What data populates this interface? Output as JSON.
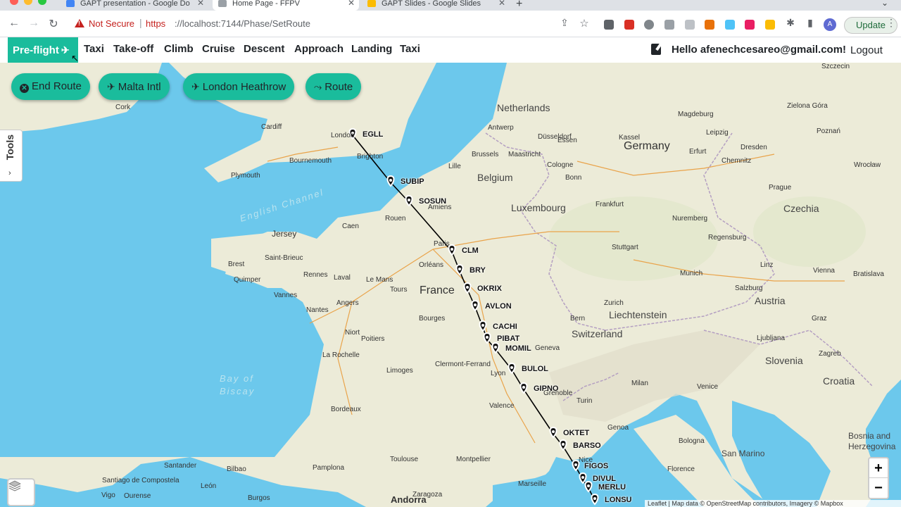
{
  "browser": {
    "tabs": [
      {
        "title": "GAPT presentation - Google Do",
        "color": "#4285f4"
      },
      {
        "title": "Home Page - FFPV",
        "color": "#9aa0a6",
        "active": true
      },
      {
        "title": "GAPT Slides - Google Slides",
        "color": "#fbbc04"
      }
    ],
    "security_label": "Not Secure",
    "url_scheme": "https",
    "url_rest": "://localhost:7144/Phase/SetRoute",
    "profile_initial": "A",
    "update_label": "Update"
  },
  "navbar": {
    "phases": [
      {
        "label": "Pre-flight",
        "active": true
      },
      {
        "label": "Taxi"
      },
      {
        "label": "Take-off"
      },
      {
        "label": "Climb"
      },
      {
        "label": "Cruise"
      },
      {
        "label": "Descent"
      },
      {
        "label": "Approach"
      },
      {
        "label": "Landing"
      },
      {
        "label": "Taxi"
      }
    ],
    "greeting": "Hello afenechcesareo@gmail.com!",
    "logout": "Logout"
  },
  "map_controls": {
    "end_route": "End Route",
    "departure": "Malta Intl",
    "arrival": "London Heathrow",
    "route": "Route",
    "tools": "Tools",
    "zoom_in": "+",
    "zoom_out": "−",
    "attribution": "Leaflet | Map data © OpenStreetMap contributors, Imagery © Mapbox"
  },
  "waypoints": [
    "EGLL",
    "SUBIP",
    "SOSUN",
    "CLM",
    "BRY",
    "OKRIX",
    "AVLON",
    "CACHI",
    "PIBAT",
    "MOMIL",
    "BULOL",
    "GIPNO",
    "OKTET",
    "BARSO",
    "FIGOS",
    "DIVUL",
    "MERLU",
    "LONSU"
  ],
  "countries": [
    "Netherlands",
    "Germany",
    "Belgium",
    "Luxembourg",
    "Czechia",
    "France",
    "Liechtenstein",
    "Austria",
    "Switzerland",
    "Slovenia",
    "Croatia",
    "San Marino",
    "Bosnia and Herzegovina"
  ],
  "seas": [
    "English Channel",
    "Bay of Biscay"
  ],
  "cities": [
    "London",
    "Cork",
    "Cardiff",
    "Bournemouth",
    "Brighton",
    "Plymouth",
    "Jersey",
    "Saint-Brieuc",
    "Brest",
    "Quimper",
    "Vannes",
    "Rennes",
    "Laval",
    "Le Mans",
    "Caen",
    "Rouen",
    "Paris",
    "Amiens",
    "Lille",
    "Brussels",
    "Antwerp",
    "Maastricht",
    "Cologne",
    "Düsseldorf",
    "Essen",
    "Bonn",
    "Leipzig",
    "Dresden",
    "Magdeburg",
    "Chemnitz",
    "Erfurt",
    "Kassel",
    "Frankfurt",
    "Stuttgart",
    "Munich",
    "Nuremberg",
    "Regensburg",
    "Zurich",
    "Bern",
    "Geneva",
    "Lyon",
    "Grenoble",
    "Turin",
    "Milan",
    "Genoa",
    "Nice",
    "Marseille",
    "Toulouse",
    "Montpellier",
    "Bordeaux",
    "Limoges",
    "Poitiers",
    "Nantes",
    "Angers",
    "Tours",
    "Orléans",
    "Bourges",
    "Clermont-Ferrand",
    "La Rochelle",
    "Niort",
    "Valence",
    "Prague",
    "Vienna",
    "Linz",
    "Salzburg",
    "Graz",
    "Ljubljana",
    "Zagreb",
    "Bratislava",
    "Venice",
    "Bologna",
    "Florence",
    "Santander",
    "Bilbao",
    "Pamplona",
    "Zaragoza",
    "Andorra",
    "Santiago de Compostela",
    "Vigo",
    "Ourense",
    "León",
    "Burgos",
    "Szczecin",
    "Poznań",
    "Wrocław",
    "Zielona Góra"
  ]
}
